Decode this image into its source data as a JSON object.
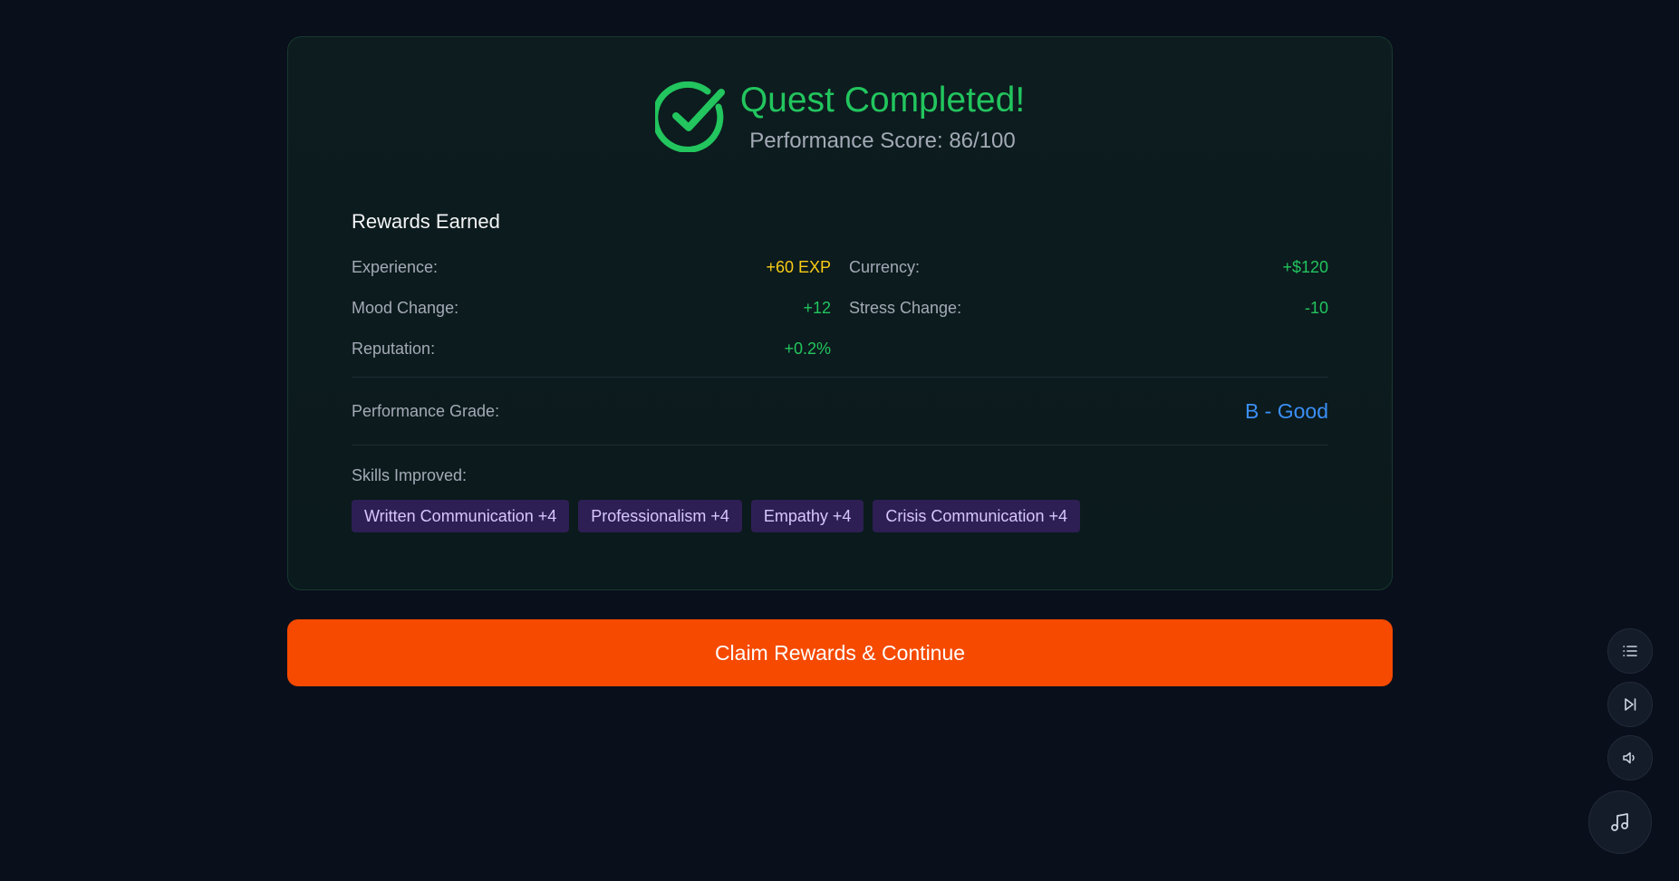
{
  "quest": {
    "title": "Quest Completed!",
    "score_text": "Performance Score: 86/100"
  },
  "rewards": {
    "title": "Rewards Earned",
    "experience_label": "Experience:",
    "experience_value": "+60 EXP",
    "currency_label": "Currency:",
    "currency_value": "+$120",
    "mood_label": "Mood Change:",
    "mood_value": "+12",
    "stress_label": "Stress Change:",
    "stress_value": "-10",
    "reputation_label": "Reputation:",
    "reputation_value": "+0.2%"
  },
  "grade": {
    "label": "Performance Grade:",
    "value": "B - Good"
  },
  "skills": {
    "label": "Skills Improved:",
    "items": [
      "Written Communication +4",
      "Professionalism +4",
      "Empathy +4",
      "Crisis Communication +4"
    ]
  },
  "actions": {
    "claim_label": "Claim Rewards & Continue"
  },
  "side_controls": {
    "icons": [
      "list-icon",
      "skip-forward-icon",
      "volume-icon",
      "music-icon"
    ]
  },
  "colors": {
    "accent_green": "#22c55e",
    "gold": "#facc15",
    "grade_blue": "#3b8ff6",
    "button_orange": "#f54a00",
    "skill_bg": "#2d1f54"
  }
}
